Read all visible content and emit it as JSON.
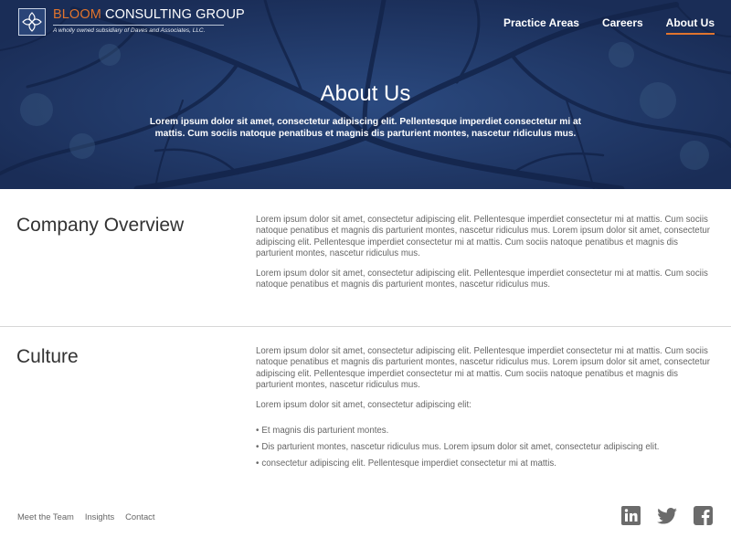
{
  "header": {
    "logo": {
      "title_accent": "BLOOM",
      "title_rest": " CONSULTING GROUP",
      "tagline": "A wholly owned subsidiary of Daves and Associates, LLC."
    },
    "nav": [
      {
        "label": "Practice Areas",
        "active": false
      },
      {
        "label": "Careers",
        "active": false
      },
      {
        "label": "About Us",
        "active": true
      }
    ],
    "accent_color": "#e0742e"
  },
  "hero": {
    "title": "About Us",
    "text": "Lorem ipsum dolor sit amet, consectetur adipiscing elit. Pellentesque imperdiet consectetur mi at mattis. Cum sociis natoque penatibus et magnis dis parturient montes, nascetur ridiculus mus.",
    "background_color": "#1e3463"
  },
  "sections": {
    "overview": {
      "title": "Company Overview",
      "paragraphs": [
        "Lorem ipsum dolor sit amet, consectetur adipiscing elit. Pellentesque imperdiet consectetur mi at mattis. Cum sociis natoque penatibus et magnis dis parturient montes, nascetur ridiculus mus. Lorem ipsum dolor sit amet, consectetur adipiscing elit. Pellentesque imperdiet consectetur mi at mattis. Cum sociis natoque penatibus et magnis dis parturient montes, nascetur ridiculus mus.",
        "Lorem ipsum dolor sit amet, consectetur adipiscing elit. Pellentesque imperdiet consectetur mi at mattis. Cum sociis natoque penatibus et magnis dis parturient montes, nascetur ridiculus mus."
      ]
    },
    "culture": {
      "title": "Culture",
      "paragraphs": [
        "Lorem ipsum dolor sit amet, consectetur adipiscing elit. Pellentesque imperdiet consectetur mi at mattis. Cum sociis natoque penatibus et magnis dis parturient montes, nascetur ridiculus mus. Lorem ipsum dolor sit amet, consectetur adipiscing elit. Pellentesque imperdiet consectetur mi at mattis. Cum sociis natoque penatibus et magnis dis parturient montes, nascetur ridiculus mus.",
        "Lorem ipsum dolor sit amet, consectetur adipiscing elit:"
      ],
      "bullet_glyph": "•",
      "bullets": [
        "Et magnis dis parturient montes.",
        "Dis parturient montes, nascetur ridiculus mus. Lorem ipsum dolor sit amet, consectetur adipiscing elit.",
        "consectetur adipiscing elit. Pellentesque imperdiet consectetur mi at mattis."
      ]
    }
  },
  "footer": {
    "links": [
      "Meet the Team",
      "Insights",
      "Contact"
    ],
    "social": [
      {
        "icon": "linkedin-icon"
      },
      {
        "icon": "twitter-icon"
      },
      {
        "icon": "facebook-icon"
      }
    ],
    "icon_color": "#6b6b6b"
  }
}
